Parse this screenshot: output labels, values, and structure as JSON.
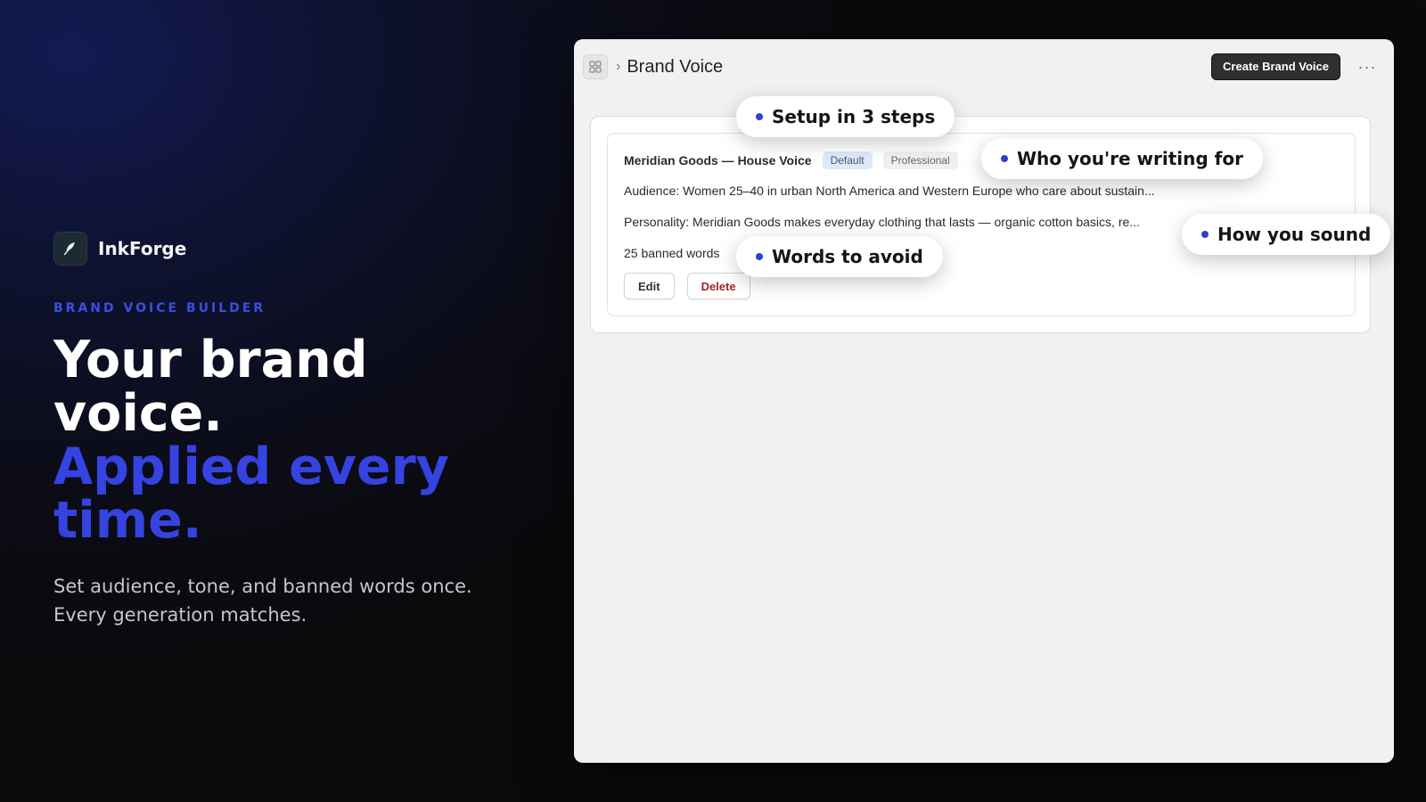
{
  "brand": {
    "name": "InkForge",
    "icon": "feather-icon",
    "eyebrow": "BRAND VOICE BUILDER",
    "headline_line1": "Your brand voice.",
    "headline_line2": "Applied every time.",
    "subcopy": "Set audience, tone, and banned words once. Every generation matches.",
    "accent_color": "#3543e0"
  },
  "app": {
    "app_icon": "grid-icon",
    "breadcrumb_separator": "›",
    "page_title": "Brand Voice",
    "create_button_label": "Create Brand Voice",
    "more_menu_label": "···"
  },
  "voice_card": {
    "name": "Meridian Goods — House Voice",
    "badges": [
      "Default",
      "Professional"
    ],
    "audience": "Audience: Women 25–40 in urban North America and Western Europe who care about sustain...",
    "personality": "Personality: Meridian Goods makes everyday clothing that lasts — organic cotton basics, re...",
    "banned_words": "25 banned words",
    "edit_label": "Edit",
    "delete_label": "Delete"
  },
  "callouts": {
    "setup": "Setup in 3 steps",
    "audience": "Who you're writing for",
    "sound": "How you sound",
    "avoid": "Words to avoid"
  }
}
